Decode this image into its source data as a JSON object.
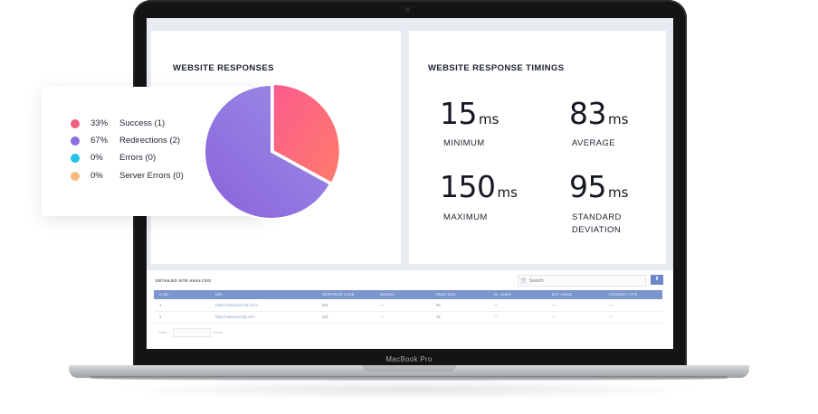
{
  "device": {
    "brand_label": "MacBook Pro"
  },
  "responses": {
    "title": "WEBSITE RESPONSES",
    "legend": [
      {
        "pct": "33%",
        "label": "Success (1)",
        "color": "#f0607e"
      },
      {
        "pct": "67%",
        "label": "Redirections (2)",
        "color": "#8b6fdc"
      },
      {
        "pct": "0%",
        "label": "Errors  (0)",
        "color": "#26c2e6"
      },
      {
        "pct": "0%",
        "label": "Server Errors  (0)",
        "color": "#f8b97c"
      }
    ]
  },
  "chart_data": {
    "type": "pie",
    "title": "WEBSITE RESPONSES",
    "slices": [
      {
        "label": "Success (1)",
        "value": 33,
        "color": "#f8617c"
      },
      {
        "label": "Redirections (2)",
        "value": 67,
        "color": "#8f73df"
      },
      {
        "label": "Errors (0)",
        "value": 0,
        "color": "#26c2e6"
      },
      {
        "label": "Server Errors (0)",
        "value": 0,
        "color": "#f8b97c"
      }
    ]
  },
  "timings": {
    "title": "WEBSITE RESPONSE TIMINGS",
    "unit": "ms",
    "minimum": {
      "value": "15",
      "label": "MINIMUM"
    },
    "average": {
      "value": "83",
      "label": "AVERAGE"
    },
    "maximum": {
      "value": "150",
      "label": "MAXIMUM"
    },
    "std_dev": {
      "value": "95",
      "label_line1": "STANDARD",
      "label_line2": "DEVIATION"
    }
  },
  "table": {
    "title": "DETAILED SITE ANALYSIS",
    "search_placeholder": "Search",
    "download_icon": "download-icon",
    "columns": [
      "S.NO.",
      "URL",
      "RESPONSE CODE",
      "IMAGES",
      "PAGE SIZE",
      "IN. LINKS",
      "EXT. LINKS",
      "CONTENT TYPE"
    ],
    "rows": [
      [
        "1",
        "https://zaduniversity.com/",
        "301",
        "—",
        "95",
        "—",
        "—",
        "—"
      ],
      [
        "2",
        "http://zaduniversity.com",
        "301",
        "—",
        "15",
        "—",
        "—",
        "—"
      ]
    ],
    "pager_show": "Show",
    "pager_entries": "Items"
  }
}
